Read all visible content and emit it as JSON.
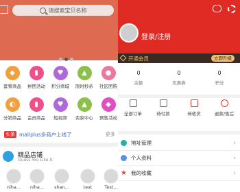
{
  "left": {
    "search_placeholder": "请搜索宝贝名称",
    "menu_row1": [
      {
        "label": "套餐商品",
        "color": "#f0a040"
      },
      {
        "label": "拼团活动",
        "color": "#f0508a"
      },
      {
        "label": "积分商城",
        "color": "#b06ad8"
      },
      {
        "label": "限时秒杀",
        "color": "#8cc04a"
      },
      {
        "label": "社区团购",
        "color": "#e87aa0"
      }
    ],
    "menu_row2": [
      {
        "label": "分销商品",
        "color": "#f0a040"
      },
      {
        "label": "会员商品",
        "color": "#f0508a"
      },
      {
        "label": "短视频",
        "color": "#b06ad8"
      },
      {
        "label": "卖家中心",
        "color": "#8cc04a"
      },
      {
        "label": "预售活动",
        "color": "#e050c0"
      }
    ],
    "notice": {
      "tag": "头条",
      "text": "mallplus多商户上线了",
      "more": "更多"
    },
    "shop": {
      "title": "精品店铺",
      "subtitle": "Guess You Like It"
    },
    "avatars": [
      "niha...",
      "niha...",
      "shan...",
      "test",
      "Test..."
    ]
  },
  "right": {
    "login_text": "登录/注册",
    "vip_text": "开通会员",
    "upgrade_label": "立即升级",
    "stats": [
      {
        "value": "0",
        "label": "余额"
      },
      {
        "value": "0",
        "label": "优惠券"
      },
      {
        "value": "0",
        "label": "积分"
      }
    ],
    "orders": [
      {
        "label": "全部订单"
      },
      {
        "label": "待付款"
      },
      {
        "label": "待收货"
      },
      {
        "label": "退款/售后"
      }
    ],
    "rows": [
      {
        "label": "地址管理",
        "color": "#27b0a0"
      },
      {
        "label": "个人资料",
        "color": "#5a8ee8"
      },
      {
        "label": "我的收藏",
        "color": "#e04a4a"
      }
    ]
  }
}
